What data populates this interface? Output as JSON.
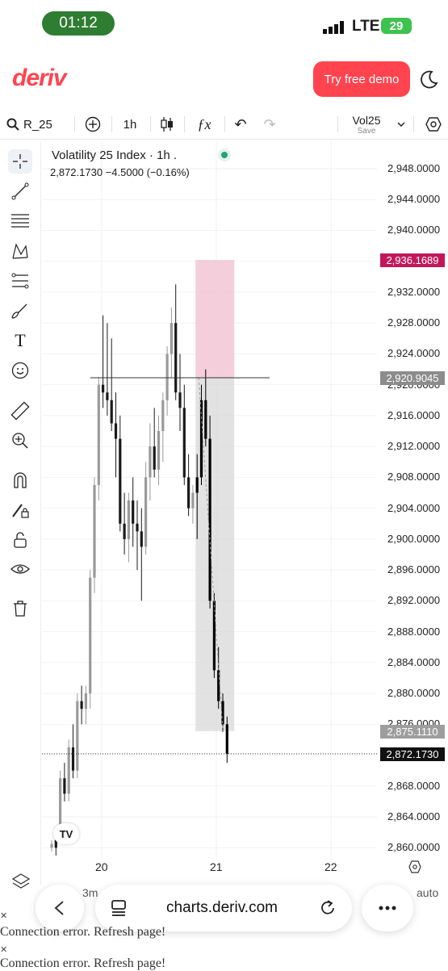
{
  "status_bar": {
    "time": "01:12",
    "network": "LTE",
    "battery": "29"
  },
  "header": {
    "logo": "deriv",
    "demo_button": "Try free demo"
  },
  "toolbar": {
    "symbol": "R_25",
    "interval": "1h",
    "template_name": "Vol25",
    "template_save": "Save"
  },
  "legend": {
    "title": "Volatility 25 Index · 1h .",
    "values": "2,872.1730  −4.5000  (−0.16%)"
  },
  "price_axis": {
    "labels": [
      "2,948.0000",
      "2,944.0000",
      "2,940.0000",
      "2,932.0000",
      "2,928.0000",
      "2,924.0000",
      "2,920.0000",
      "2,916.0000",
      "2,912.0000",
      "2,908.0000",
      "2,904.0000",
      "2,900.0000",
      "2,896.0000",
      "2,892.0000",
      "2,888.0000",
      "2,884.0000",
      "2,880.0000",
      "2,876.0000",
      "2,868.0000",
      "2,864.0000",
      "2,860.0000"
    ],
    "stop_tag": "2,936.1689",
    "entry_tag": "2,920.9045",
    "target_tag": "2,875.1110",
    "last_tag": "2,872.1730"
  },
  "time_axis": {
    "labels": [
      "20",
      "21",
      "22"
    ]
  },
  "bottom": {
    "period": "3m",
    "scale": "auto"
  },
  "browser": {
    "url": "charts.deriv.com"
  },
  "errors": [
    "Connection error. Refresh page!",
    "Connection error. Refresh page!"
  ],
  "colors": {
    "brand": "#ff444f",
    "stop": "#c2185b",
    "live": "#26a17a"
  },
  "chart_data": {
    "type": "candlestick",
    "title": "Volatility 25 Index · 1h .",
    "xlabel": "",
    "ylabel": "",
    "x_ticks": [
      "20",
      "21",
      "22"
    ],
    "ylim": [
      2858,
      2950
    ],
    "last_price": 2872.173,
    "horizontal_line": 2920.9045,
    "position": {
      "entry": 2920.9045,
      "stop": 2936.1689,
      "target": 2875.111
    },
    "candles": [
      [
        2860,
        2861,
        2859.5,
        2860.5
      ],
      [
        2861,
        2862,
        2859,
        2860
      ],
      [
        2862,
        2870,
        2861,
        2869
      ],
      [
        2869,
        2871,
        2866,
        2867
      ],
      [
        2867,
        2874,
        2866,
        2873
      ],
      [
        2873,
        2876,
        2869,
        2870
      ],
      [
        2870,
        2880,
        2869,
        2879
      ],
      [
        2879,
        2881,
        2876,
        2878
      ],
      [
        2878,
        2881,
        2876,
        2880
      ],
      [
        2880,
        2896,
        2878,
        2895
      ],
      [
        2895,
        2908,
        2893,
        2907
      ],
      [
        2907,
        2921,
        2905,
        2920
      ],
      [
        2920,
        2929,
        2917,
        2919
      ],
      [
        2919,
        2928,
        2916,
        2918
      ],
      [
        2918,
        2926,
        2914,
        2915
      ],
      [
        2915,
        2919,
        2908,
        2913
      ],
      [
        2913,
        2916,
        2901,
        2902
      ],
      [
        2902,
        2906,
        2898,
        2900
      ],
      [
        2900,
        2906,
        2897,
        2905
      ],
      [
        2905,
        2908,
        2899,
        2902
      ],
      [
        2902,
        2905,
        2896,
        2901
      ],
      [
        2901,
        2904,
        2892,
        2899
      ],
      [
        2899,
        2910,
        2898,
        2908
      ],
      [
        2908,
        2915,
        2905,
        2912
      ],
      [
        2912,
        2917,
        2908,
        2909
      ],
      [
        2909,
        2916,
        2907,
        2914
      ],
      [
        2914,
        2919,
        2910,
        2918
      ],
      [
        2918,
        2925,
        2916,
        2924
      ],
      [
        2924,
        2930,
        2921,
        2928
      ],
      [
        2928,
        2933,
        2918,
        2919
      ],
      [
        2919,
        2924,
        2914,
        2917
      ],
      [
        2917,
        2920,
        2907,
        2908
      ],
      [
        2908,
        2911,
        2903,
        2904
      ],
      [
        2904,
        2907,
        2902,
        2906
      ],
      [
        2906,
        2911,
        2900,
        2908
      ],
      [
        2908,
        2920,
        2907,
        2918
      ],
      [
        2918,
        2922,
        2912,
        2913
      ],
      [
        2913,
        2916,
        2891,
        2892
      ],
      [
        2892,
        2893,
        2882,
        2883
      ],
      [
        2883,
        2886,
        2878,
        2879
      ],
      [
        2879,
        2880,
        2875,
        2876
      ],
      [
        2876,
        2877,
        2871,
        2872.173
      ]
    ]
  }
}
